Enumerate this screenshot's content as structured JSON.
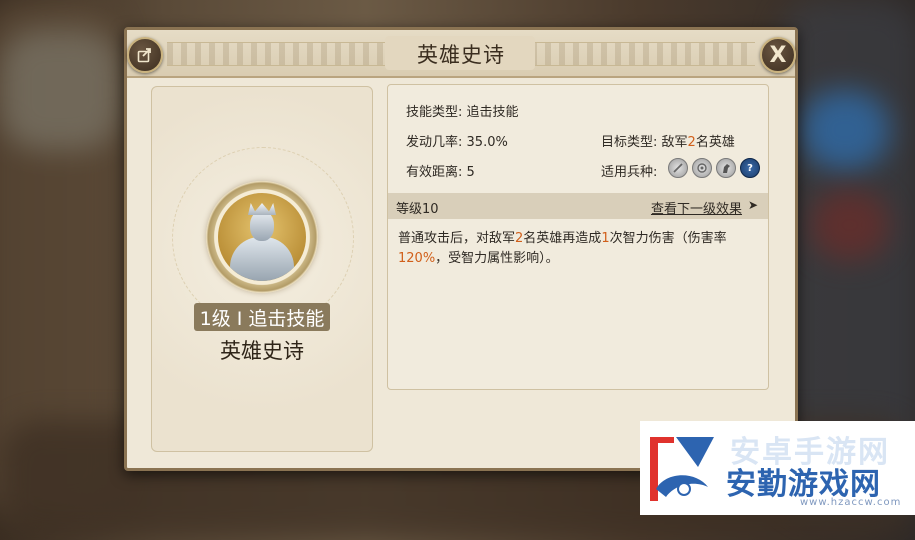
{
  "dialog": {
    "title": "英雄史诗",
    "close_label": "X"
  },
  "skill_card": {
    "level_badge": "1级 I 追击技能",
    "name": "英雄史诗"
  },
  "details": {
    "skill_type_label": "技能类型:",
    "skill_type_value": "追击技能",
    "trigger_rate_label": "发动几率:",
    "trigger_rate_value": "35.0%",
    "target_label": "目标类型:",
    "target_prefix": "敌军",
    "target_count": "2",
    "target_suffix": "名英雄",
    "range_label": "有效距离:",
    "range_value": "5",
    "troop_label": "适用兵种:",
    "troop_icons": [
      "sword-icon",
      "target-icon",
      "horse-icon",
      "question-icon"
    ],
    "troop_question": "?"
  },
  "level_section": {
    "level": "等级10",
    "next_link": "查看下一级效果",
    "arrow": "➤"
  },
  "description": {
    "part1": "普通攻击后，对敌军",
    "count_targets": "2",
    "part2": "名英雄再造成",
    "count_hits": "1",
    "part3": "次智力伤害（伤害率",
    "rate": "120%",
    "part4": "，受智力属性影响）。"
  },
  "watermark": {
    "ghost_text": "安卓手游网",
    "text": "安勤游戏网",
    "url": "www.hzaccw.com"
  },
  "colors": {
    "highlight": "#d15f1a",
    "panel": "#efe8d8",
    "accent_blue": "#2d64b0"
  }
}
